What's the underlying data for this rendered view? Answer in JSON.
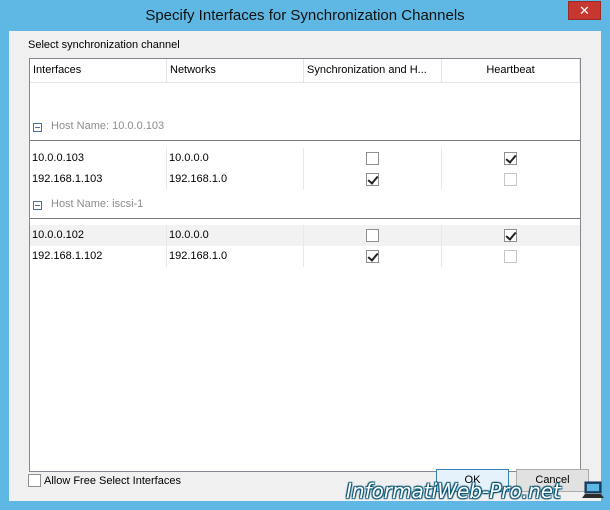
{
  "window": {
    "title": "Specify Interfaces for Synchronization Channels",
    "close_glyph": "✕"
  },
  "section_label": "Select synchronization channel",
  "grid": {
    "columns": [
      "Interfaces",
      "Networks",
      "Synchronization and H...",
      "Heartbeat"
    ],
    "groups": [
      {
        "label": "Host Name: 10.0.0.103",
        "rows": [
          {
            "interface": "10.0.0.103",
            "network": "10.0.0.0",
            "sync": false,
            "heartbeat": true
          },
          {
            "interface": "192.168.1.103",
            "network": "192.168.1.0",
            "sync": true,
            "heartbeat": false
          }
        ]
      },
      {
        "label": "Host Name: iscsi-1",
        "rows": [
          {
            "interface": "10.0.0.102",
            "network": "10.0.0.0",
            "sync": false,
            "heartbeat": true
          },
          {
            "interface": "192.168.1.102",
            "network": "192.168.1.0",
            "sync": true,
            "heartbeat": false
          }
        ]
      }
    ]
  },
  "free_select": {
    "label": "Allow Free Select Interfaces",
    "checked": false
  },
  "buttons": {
    "ok": "OK",
    "cancel": "Cancel"
  },
  "watermark": "InformatiWeb-Pro.net",
  "colors": {
    "title_bar": "#5fb8e3",
    "close_button": "#c7372f",
    "group_label": "#8c8c8c"
  }
}
